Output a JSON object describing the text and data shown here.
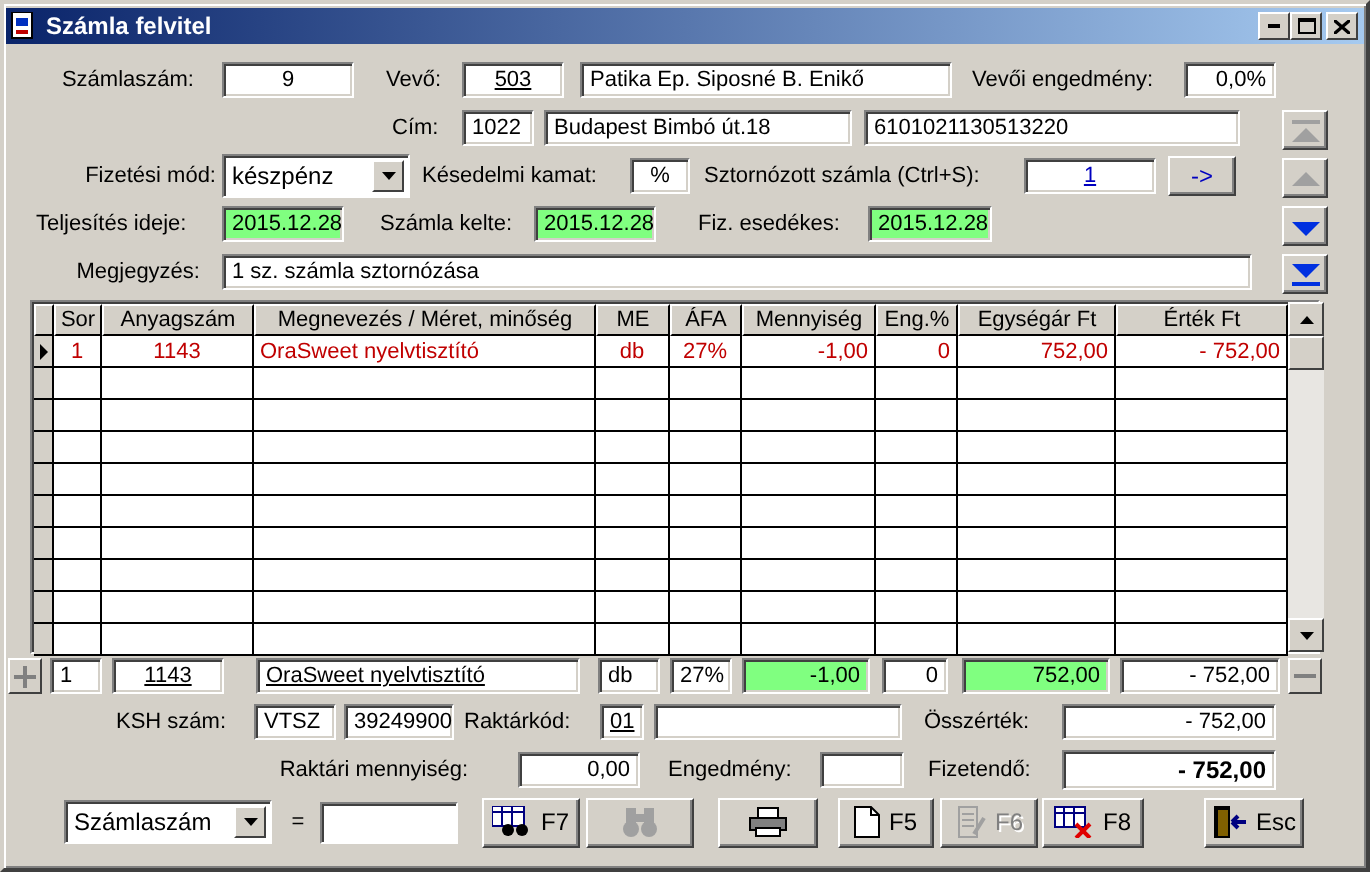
{
  "window": {
    "title": "Számla felvitel"
  },
  "form_rows": [
    {
      "items": [
        {
          "kind": "label",
          "text": "Számlaszám:"
        },
        {
          "kind": "field",
          "value": "9"
        },
        {
          "kind": "label",
          "text": "Vevő:"
        },
        {
          "kind": "field",
          "value": "503",
          "underlined": true
        },
        {
          "kind": "field",
          "value": "Patika Ep. Siposné B. Enikő"
        },
        {
          "kind": "label",
          "text": "Vevői engedmény:"
        },
        {
          "kind": "field",
          "value": "0,0%"
        }
      ]
    },
    {
      "items": [
        {
          "kind": "label",
          "text": "Cím:"
        },
        {
          "kind": "field",
          "value": "1022"
        },
        {
          "kind": "field",
          "value": "Budapest Bimbó út.18"
        },
        {
          "kind": "field",
          "value": "6101021130513220"
        }
      ]
    },
    {
      "items": [
        {
          "kind": "label",
          "text": "Fizetési mód:"
        },
        {
          "kind": "combo",
          "value": "készpénz"
        },
        {
          "kind": "label",
          "text": "Késedelmi kamat:"
        },
        {
          "kind": "field",
          "value": "%"
        },
        {
          "kind": "label",
          "text": "Sztornózott számla (Ctrl+S):"
        },
        {
          "kind": "field",
          "value": "1",
          "link": true
        },
        {
          "kind": "button",
          "text": "->"
        }
      ]
    },
    {
      "items": [
        {
          "kind": "label",
          "text": "Teljesítés ideje:"
        },
        {
          "kind": "field",
          "value": "2015.12.28",
          "highlighted": true
        },
        {
          "kind": "label",
          "text": "Számla kelte:"
        },
        {
          "kind": "field",
          "value": "2015.12.28",
          "highlighted": true
        },
        {
          "kind": "label",
          "text": "Fiz. esedékes:"
        },
        {
          "kind": "field",
          "value": "2015.12.28",
          "highlighted": true
        }
      ]
    },
    {
      "items": [
        {
          "kind": "label",
          "text": "Megjegyzés:"
        },
        {
          "kind": "field",
          "value": "1 sz. számla sztornózása"
        }
      ]
    }
  ],
  "nav_buttons": [
    {
      "kind": "first",
      "disabled": true
    },
    {
      "kind": "prev",
      "disabled": true
    },
    {
      "kind": "next",
      "disabled": false
    },
    {
      "kind": "last",
      "disabled": false
    }
  ],
  "table": {
    "columns": [
      "Sor",
      "Anyagszám",
      "Megnevezés / Méret, minőség",
      "ME",
      "ÁFA",
      "Mennyiség",
      "Eng.%",
      "Egységár Ft",
      "Érték Ft"
    ],
    "rows": [
      {
        "selected": true,
        "cells": [
          "1",
          "1143",
          "OraSweet nyelvtisztító",
          "db",
          "27%",
          "-1,00",
          "0",
          "752,00",
          "- 752,00"
        ]
      }
    ]
  },
  "edit_row": {
    "items": [
      {
        "kind": "add"
      },
      {
        "kind": "field",
        "value": "1"
      },
      {
        "kind": "field",
        "value": "1143",
        "underlined": true
      },
      {
        "kind": "field",
        "value": "OraSweet nyelvtisztító",
        "underlined": true
      },
      {
        "kind": "field",
        "value": "db"
      },
      {
        "kind": "field",
        "value": "27%"
      },
      {
        "kind": "field",
        "value": "-1,00",
        "highlighted": true
      },
      {
        "kind": "field",
        "value": "0"
      },
      {
        "kind": "field",
        "value": "752,00",
        "highlighted": true
      },
      {
        "kind": "field",
        "value": "- 752,00"
      },
      {
        "kind": "remove"
      }
    ]
  },
  "summary_rows": [
    {
      "items": [
        {
          "kind": "label",
          "text": "KSH szám:"
        },
        {
          "kind": "field",
          "value": "VTSZ"
        },
        {
          "kind": "field",
          "value": "39249900"
        },
        {
          "kind": "label",
          "text": "Raktárkód:"
        },
        {
          "kind": "field",
          "value": "01",
          "underlined": true
        },
        {
          "kind": "field"
        },
        {
          "kind": "label",
          "text": "Összérték:"
        },
        {
          "kind": "field",
          "value": "- 752,00"
        }
      ]
    },
    {
      "items": [
        {
          "kind": "label",
          "text": "Raktári mennyiség:"
        },
        {
          "kind": "field",
          "value": "0,00"
        },
        {
          "kind": "label",
          "text": "Engedmény:"
        },
        {
          "kind": "field"
        },
        {
          "kind": "label",
          "text": "Fizetendő:"
        },
        {
          "kind": "field",
          "value": "- 752,00",
          "bold": true
        }
      ]
    }
  ],
  "toolbar": {
    "items": [
      {
        "kind": "combo",
        "value": "Számlaszám"
      },
      {
        "kind": "label",
        "text": "="
      },
      {
        "kind": "input"
      },
      {
        "kind": "find",
        "text": "F7",
        "disabled": false
      },
      {
        "kind": "binoculars",
        "disabled": true
      },
      {
        "kind": "print",
        "disabled": false
      },
      {
        "kind": "new",
        "text": "F5",
        "disabled": false
      },
      {
        "kind": "edit",
        "text": "F6",
        "disabled": true
      },
      {
        "kind": "delete",
        "text": "F8",
        "disabled": false
      },
      {
        "kind": "exit",
        "text": "Esc",
        "disabled": false
      }
    ]
  }
}
